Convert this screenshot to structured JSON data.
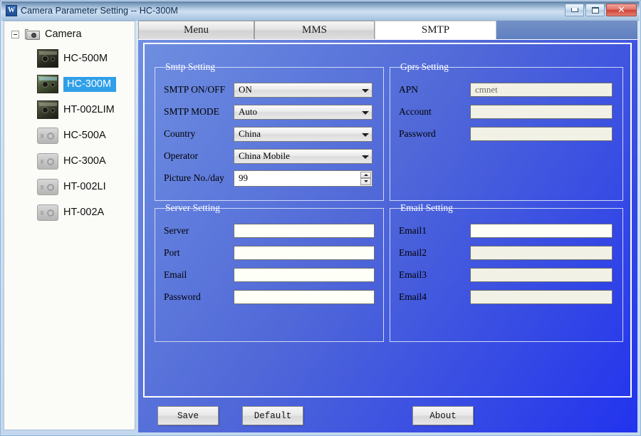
{
  "window": {
    "title": "Camera Parameter Setting -- HC-300M",
    "app_icon": "w-logo-icon",
    "controls": {
      "minimize": "minimize-icon",
      "maximize": "maximize-icon",
      "close": "✕"
    }
  },
  "sidebar": {
    "root": {
      "label": "Camera",
      "expanded": true
    },
    "items": [
      {
        "label": "HC-500M",
        "icon": "camera-photo-icon",
        "selected": false
      },
      {
        "label": "HC-300M",
        "icon": "camera-photo-icon",
        "selected": true
      },
      {
        "label": "HT-002LIM",
        "icon": "camera-photo-icon",
        "selected": false
      },
      {
        "label": "HC-500A",
        "icon": "camera-placeholder-icon",
        "selected": false
      },
      {
        "label": "HC-300A",
        "icon": "camera-placeholder-icon",
        "selected": false
      },
      {
        "label": "HT-002LI",
        "icon": "camera-placeholder-icon",
        "selected": false
      },
      {
        "label": "HT-002A",
        "icon": "camera-placeholder-icon",
        "selected": false
      }
    ]
  },
  "tabs": [
    {
      "label": "Menu",
      "active": false
    },
    {
      "label": "MMS",
      "active": false
    },
    {
      "label": "SMTP",
      "active": true
    }
  ],
  "groups": {
    "smtp": {
      "title": "Smtp Setting",
      "fields": [
        {
          "label": "SMTP ON/OFF",
          "type": "combo",
          "value": "ON"
        },
        {
          "label": "SMTP MODE",
          "type": "combo",
          "value": "Auto"
        },
        {
          "label": "Country",
          "type": "combo",
          "value": "China"
        },
        {
          "label": "Operator",
          "type": "combo",
          "value": "China Mobile"
        },
        {
          "label": "Picture No./day",
          "type": "spin",
          "value": "99"
        }
      ]
    },
    "gprs": {
      "title": "Gprs Setting",
      "fields": [
        {
          "label": "APN",
          "type": "text",
          "value": "cmnet",
          "enabled": false
        },
        {
          "label": "Account",
          "type": "text",
          "value": "",
          "enabled": false
        },
        {
          "label": "Password",
          "type": "text",
          "value": "",
          "enabled": false
        }
      ]
    },
    "server": {
      "title": "Server Setting",
      "fields": [
        {
          "label": "Server",
          "type": "text",
          "value": "",
          "enabled": true
        },
        {
          "label": "Port",
          "type": "text",
          "value": "",
          "enabled": true
        },
        {
          "label": "Email",
          "type": "text",
          "value": "",
          "enabled": true
        },
        {
          "label": "Password",
          "type": "text",
          "value": "",
          "enabled": true
        }
      ]
    },
    "email": {
      "title": "Email Setting",
      "fields": [
        {
          "label": "Email1",
          "type": "text",
          "value": "",
          "enabled": true
        },
        {
          "label": "Email2",
          "type": "text",
          "value": "",
          "enabled": false
        },
        {
          "label": "Email3",
          "type": "text",
          "value": "",
          "enabled": false
        },
        {
          "label": "Email4",
          "type": "text",
          "value": "",
          "enabled": false
        }
      ]
    }
  },
  "buttons": {
    "save": "Save",
    "default": "Default",
    "about": "About"
  },
  "colors": {
    "panel_blue_light": "#6f8fe0",
    "panel_blue_deep": "#2233ee",
    "selection_blue": "#2f9fe8",
    "close_red": "#cf4334",
    "titlebar_blue": "#cfe0f2"
  }
}
